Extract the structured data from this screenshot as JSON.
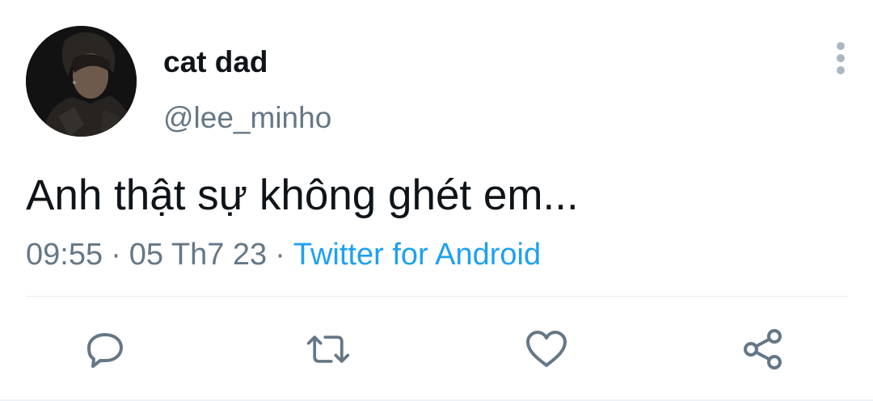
{
  "user": {
    "display_name": "cat dad",
    "handle": "@lee_minho"
  },
  "tweet": {
    "text": "Anh thật sự không ghét em...",
    "time": "09:55",
    "date": "05 Th7 23",
    "separator": "·",
    "source": "Twitter for Android"
  },
  "icons": {
    "more": "more-vertical-icon",
    "reply": "reply-icon",
    "retweet": "retweet-icon",
    "like": "heart-icon",
    "share": "share-icon"
  },
  "colors": {
    "text_primary": "#0f1419",
    "text_secondary": "#657786",
    "link": "#1da1f2",
    "icon": "#657786",
    "divider": "#e6ecf0"
  }
}
